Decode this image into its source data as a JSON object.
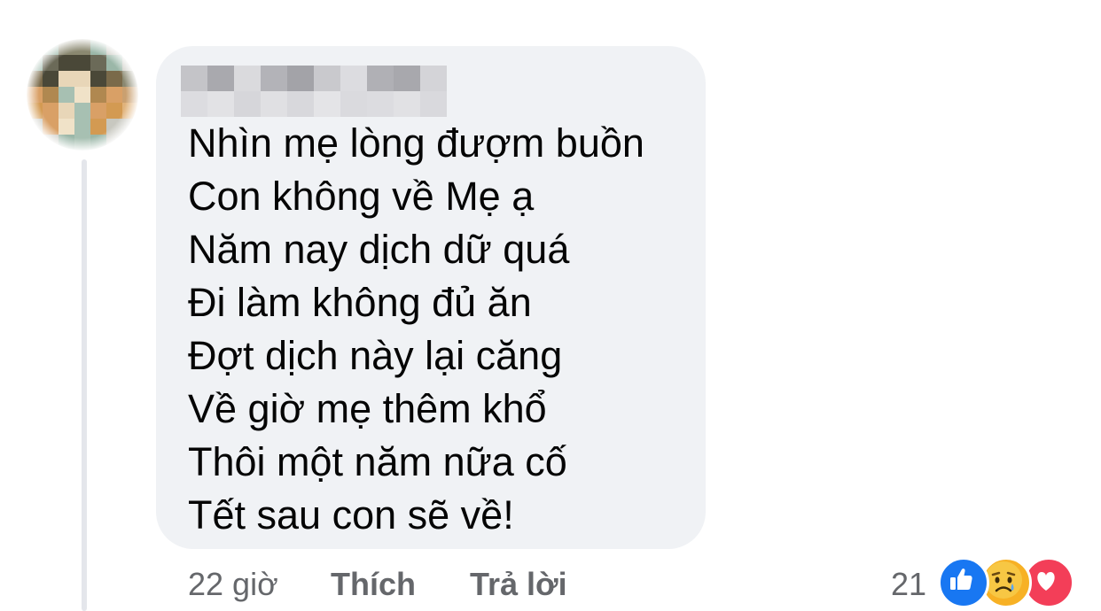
{
  "comment": {
    "lines": [
      "Nhìn mẹ lòng đượm buồn",
      "Con không về Mẹ ạ",
      "Năm nay dịch dữ quá",
      "Đi làm không đủ ăn",
      "Đợt dịch này lại căng",
      "Về giờ mẹ thêm khổ",
      "Thôi một năm nữa cố",
      "Tết sau con sẽ về!"
    ],
    "time": "22 giờ",
    "like_label": "Thích",
    "reply_label": "Trả lời",
    "reaction_count": "21",
    "reactions": [
      "like-icon",
      "sad-icon",
      "love-icon"
    ]
  },
  "colors": {
    "bubble": "#f0f2f5",
    "text": "#050505",
    "secondary": "#65676b",
    "like": "#1877f2",
    "love": "#f33e58",
    "sad": "#f7b125"
  }
}
